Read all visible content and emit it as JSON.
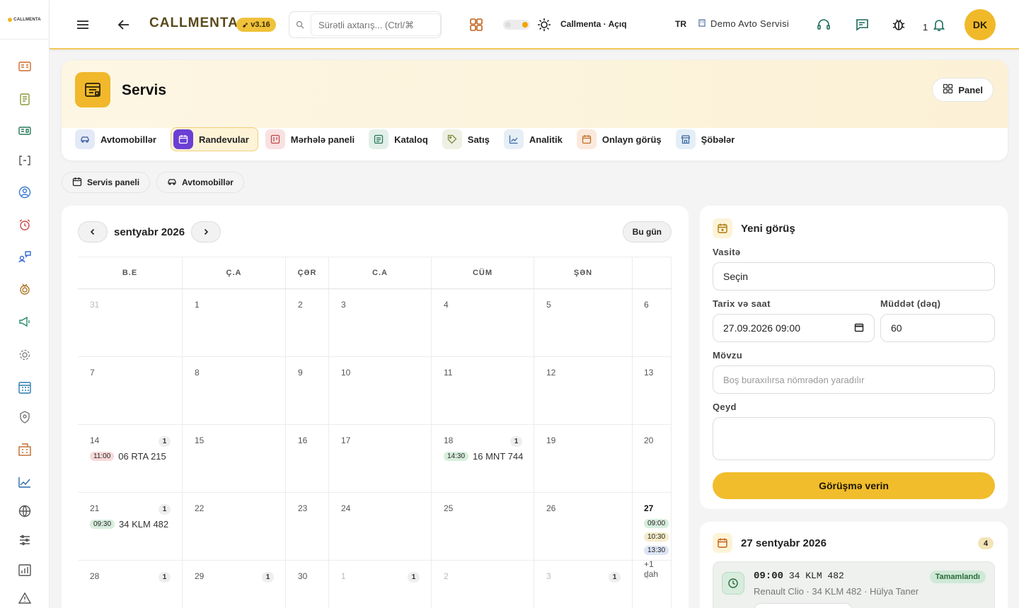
{
  "topbar": {
    "brand": "CALLMENTA",
    "title": "CALLMENTA",
    "version": "v3.16",
    "search_placeholder": "Sürətli axtarış... (Ctrl/⌘",
    "mode_label": "Callmenta · Açıq",
    "lang": "TR",
    "org": "Demo Avto Servisi",
    "notif_count": "1",
    "avatar": "DK"
  },
  "service": {
    "title": "Servis",
    "panel_label": "Panel",
    "tabs": [
      {
        "label": "Avtomobillər",
        "color": "#e3e9f7",
        "icon": "car-icon"
      },
      {
        "label": "Randevular",
        "color": "#6b3fd4",
        "icon": "calendar-icon",
        "active": true
      },
      {
        "label": "Mərhələ paneli",
        "color": "#f9e1e1",
        "icon": "kanban-icon"
      },
      {
        "label": "Kataloq",
        "color": "#e2efe9",
        "icon": "list-icon"
      },
      {
        "label": "Satış",
        "color": "#eef0e4",
        "icon": "tag-icon"
      },
      {
        "label": "Analitik",
        "color": "#e6eef6",
        "icon": "chart-icon"
      },
      {
        "label": "Onlayn görüş",
        "color": "#fbe9dc",
        "icon": "calendar-icon"
      },
      {
        "label": "Şöbələr",
        "color": "#e4eef7",
        "icon": "store-icon"
      }
    ]
  },
  "breadcrumbs": [
    {
      "label": "Servis paneli",
      "icon": "calendar-icon"
    },
    {
      "label": "Avtomobillər",
      "icon": "car-icon"
    }
  ],
  "calendar": {
    "month": "sentyabr 2026",
    "today_label": "Bu gün",
    "weekdays": [
      "B.E",
      "Ç.A",
      "ÇƏR",
      "C.A",
      "CÜM",
      "ŞƏN",
      ""
    ],
    "weeks": [
      [
        {
          "d": "31",
          "muted": true
        },
        {
          "d": "1"
        },
        {
          "d": "2"
        },
        {
          "d": "3"
        },
        {
          "d": "4"
        },
        {
          "d": "5"
        },
        {
          "d": "6"
        }
      ],
      [
        {
          "d": "7"
        },
        {
          "d": "8"
        },
        {
          "d": "9"
        },
        {
          "d": "10"
        },
        {
          "d": "11"
        },
        {
          "d": "12"
        },
        {
          "d": "13"
        }
      ],
      [
        {
          "d": "14",
          "count": "1",
          "events": [
            {
              "time": "11:00",
              "plate": "06 RTA 215",
              "tone": "red"
            }
          ]
        },
        {
          "d": "15"
        },
        {
          "d": "16"
        },
        {
          "d": "17"
        },
        {
          "d": "18",
          "count": "1",
          "events": [
            {
              "time": "14:30",
              "plate": "16 MNT 744",
              "tone": "green"
            }
          ]
        },
        {
          "d": "19"
        },
        {
          "d": "20"
        }
      ],
      [
        {
          "d": "21",
          "count": "1",
          "events": [
            {
              "time": "09:30",
              "plate": "34 KLM 482",
              "tone": "green"
            }
          ]
        },
        {
          "d": "22"
        },
        {
          "d": "23"
        },
        {
          "d": "24"
        },
        {
          "d": "25"
        },
        {
          "d": "26"
        },
        {
          "d": "27",
          "bold": true,
          "chips": [
            {
              "time": "09:00",
              "tone": "green"
            },
            {
              "time": "10:30",
              "tone": "yel"
            },
            {
              "time": "13:30",
              "tone": "blue"
            }
          ],
          "more": "+1 dah"
        }
      ],
      [
        {
          "d": "28",
          "count": "1"
        },
        {
          "d": "29",
          "count": "1"
        },
        {
          "d": "30"
        },
        {
          "d": "1",
          "muted": true,
          "count": "1"
        },
        {
          "d": "2",
          "muted": true
        },
        {
          "d": "3",
          "muted": true,
          "count": "1"
        },
        {
          "d": "4",
          "muted": true
        }
      ]
    ]
  },
  "new_appointment": {
    "title": "Yeni görüş",
    "vehicle_label": "Vasitə",
    "vehicle_value": "Seçin",
    "datetime_label": "Tarix və saat",
    "datetime_value": "27.09.2026 09:00",
    "duration_label": "Müddət (dəq)",
    "duration_value": "60",
    "subject_label": "Mövzu",
    "subject_placeholder": "Boş buraxılırsa nömrədən yaradılır",
    "note_label": "Qeyd",
    "submit_label": "Görüşmə verin"
  },
  "day_list": {
    "title": "27 sentyabr 2026",
    "count": "4",
    "items": [
      {
        "time": "09:00",
        "plate": "34 KLM 482",
        "detail": "Renault Clio · 34 KLM 482 · Hülya Taner",
        "status": "Tamamlandı"
      }
    ]
  },
  "colors": {
    "accent": "#f1bd2c",
    "brand_text": "#5a4a1a"
  }
}
